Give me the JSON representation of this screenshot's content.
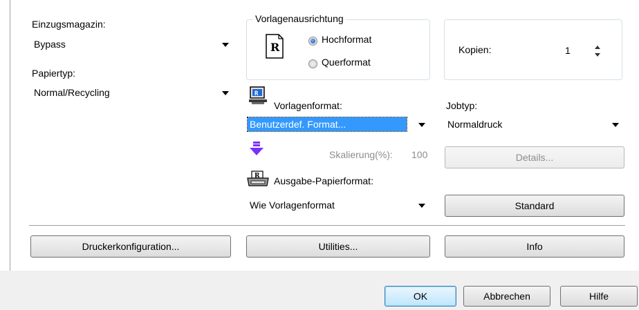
{
  "left": {
    "tray_label": "Einzugsmagazin:",
    "tray_value": "Bypass",
    "paper_type_label": "Papiertyp:",
    "paper_type_value": "Normal/Recycling"
  },
  "orientation": {
    "group_label": "Vorlagenausrichtung",
    "icon_letter": "R",
    "portrait_label": "Hochformat",
    "landscape_label": "Querformat",
    "selected": "Hochformat"
  },
  "copies": {
    "label": "Kopien:",
    "value": "1"
  },
  "original_format": {
    "label": "Vorlagenformat:",
    "value": "Benutzerdef. Format...",
    "icon": "monitor-icon"
  },
  "scaling": {
    "label": "Skalierung(%):",
    "value": "100",
    "icon": "down-arrow-icon"
  },
  "output_format": {
    "label": "Ausgabe-Papierformat:",
    "value": "Wie Vorlagenformat",
    "icon": "printer-icon"
  },
  "job": {
    "label": "Jobtyp:",
    "value": "Normaldruck",
    "details_button": "Details...",
    "standard_button": "Standard"
  },
  "bottom_buttons": {
    "printer_config": "Druckerkonfiguration...",
    "utilities": "Utilities...",
    "info": "Info"
  },
  "dialog_buttons": {
    "ok": "OK",
    "cancel": "Abbrechen",
    "help": "Hilfe"
  },
  "colors": {
    "selection": "#3399ff",
    "accent_arrow": "#7b2ff7"
  }
}
